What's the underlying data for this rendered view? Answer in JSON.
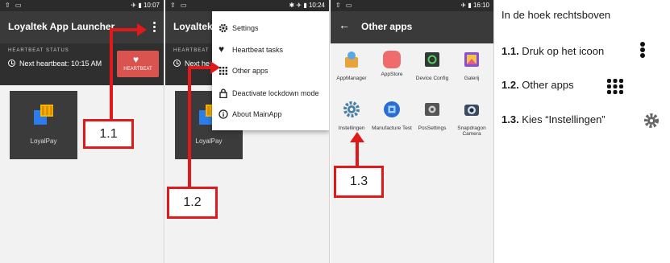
{
  "screen1": {
    "status_time": "10:07",
    "app_title": "Loyaltek App Launcher",
    "heartbeat_status_label": "HEARTBEAT STATUS",
    "next_heartbeat": "Next heartbeat: 10:15 AM",
    "heartbeat_button": "HEARTBEAT",
    "tile_label": "LoyalPay",
    "callout": "1.1"
  },
  "screen2": {
    "status_time": "10:24",
    "app_title": "Loyaltek A",
    "heartbeat_status_label": "HEARTBEAT",
    "next_heartbeat": "Next he",
    "tile_label": "LoyalPay",
    "menu": [
      {
        "label": "Settings",
        "icon": "gear-icon"
      },
      {
        "label": "Heartbeat tasks",
        "icon": "heart-icon"
      },
      {
        "label": "Other apps",
        "icon": "grid-icon"
      },
      {
        "label": "Deactivate lockdown mode",
        "icon": "lock-icon"
      },
      {
        "label": "About MainApp",
        "icon": "info-icon"
      }
    ],
    "callout": "1.2"
  },
  "screen3": {
    "status_time": "16:10",
    "title": "Other apps",
    "apps": [
      {
        "label": "AppManager",
        "color": "#e8a33b"
      },
      {
        "label": "AppStore",
        "color": "#f06b6b"
      },
      {
        "label": "Device Config",
        "color": "#2e3b33"
      },
      {
        "label": "Galerij",
        "color": "#8a4fd8"
      },
      {
        "label": "Instellingen",
        "color": "#4a7fa8"
      },
      {
        "label": "Manufacture Test",
        "color": "#2a6fd0"
      },
      {
        "label": "PosSettings",
        "color": "#555555"
      },
      {
        "label": "Snapdragon Camera",
        "color": "#3d4a5c"
      }
    ],
    "callout": "1.3"
  },
  "instructions": {
    "intro": "In de hoek rechtsboven",
    "step1_num": "1.1.",
    "step1_text": " Druk op het icoon",
    "step2_num": "1.2.",
    "step2_text": " Other apps",
    "step3_num": "1.3.",
    "step3_text": " Kies “Instellingen”"
  },
  "colors": {
    "accent_red": "#e01a1a",
    "heartbeat_red": "#d9534f",
    "appbar": "#3a3a3a"
  }
}
